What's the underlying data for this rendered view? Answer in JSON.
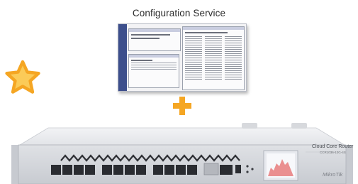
{
  "caption": "Configuration Service",
  "device": {
    "name": "Cloud Core Router",
    "model": "CCR1036-12G-4S",
    "logo": "MikroTik"
  },
  "icons": {
    "star": "star-icon",
    "plus": "plus-icon"
  },
  "colors": {
    "accent": "#F5A623",
    "accent_light": "#FBCB58",
    "caption_text": "#2B2B2B",
    "router_body": "#DCDFE3"
  }
}
